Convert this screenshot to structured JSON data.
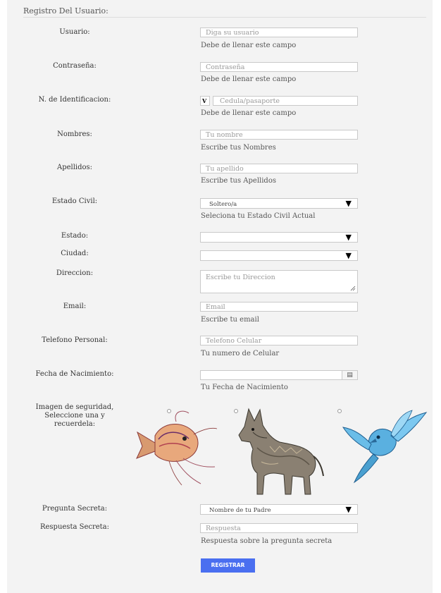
{
  "form": {
    "legend": "Registro Del Usuario:",
    "fields": {
      "usuario": {
        "label": "Usuario:",
        "placeholder": "Diga su usuario",
        "help": "Debe de llenar este campo"
      },
      "contrasena": {
        "label": "Contraseña:",
        "placeholder": "Contraseña",
        "help": "Debe de llenar este campo"
      },
      "identificacion": {
        "label": "N. de Identificacion:",
        "prefix": "V",
        "placeholder": "Cedula/pasaporte",
        "help": "Debe de llenar este campo"
      },
      "nombres": {
        "label": "Nombres:",
        "placeholder": "Tu nombre",
        "help": "Escribe tus Nombres"
      },
      "apellidos": {
        "label": "Apellidos:",
        "placeholder": "Tu apellido",
        "help": "Escribe tus Apellidos"
      },
      "estado_civil": {
        "label": "Estado Civil:",
        "value": "Soltero/a",
        "help": "Seleciona tu Estado Civil Actual"
      },
      "estado": {
        "label": "Estado:",
        "value": ""
      },
      "ciudad": {
        "label": "Ciudad:",
        "value": ""
      },
      "direccion": {
        "label": "Direccion:",
        "placeholder": "Escribe tu Direccion"
      },
      "email": {
        "label": "Email:",
        "placeholder": "Email",
        "help": "Escribe tu email"
      },
      "telefono": {
        "label": "Telefono Personal:",
        "placeholder": "Telefono Celular",
        "help": "Tu numero de Celular"
      },
      "fecha": {
        "label": "Fecha de Nacimiento:",
        "value": "",
        "help": "Tu Fecha de Nacimiento"
      },
      "imagen": {
        "label_lines": [
          "Imagen de seguridad,",
          "Seleccione una y",
          "recuerdela:"
        ],
        "options": [
          "fish-artwork",
          "wolf-artwork",
          "bird-artwork"
        ]
      },
      "pregunta": {
        "label": "Pregunta Secreta:",
        "value": "Nombre de tu Padre"
      },
      "respuesta": {
        "label": "Respuesta Secreta:",
        "placeholder": "Respuesta",
        "help": "Respuesta sobre la pregunta secreta"
      }
    },
    "submit_label": "REGISTRAR",
    "icons": {
      "select_arrow": "triangle-down",
      "date": "calendar-icon"
    },
    "colors": {
      "button": "#4a6ff0",
      "panel": "#f3f3f3"
    }
  }
}
